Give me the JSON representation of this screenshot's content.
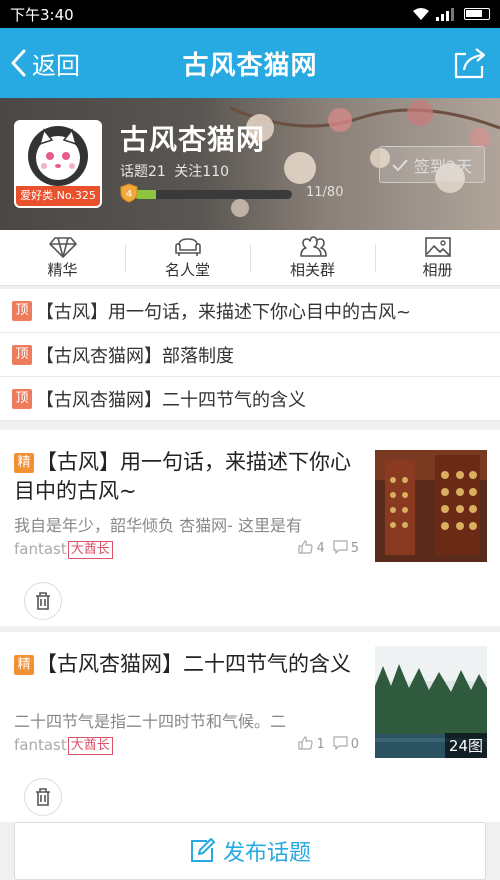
{
  "status_bar": {
    "time": "下午3:40"
  },
  "nav": {
    "back_label": "返回",
    "title": "古风杏猫网"
  },
  "tribe": {
    "name": "古风杏猫网",
    "topics_label": "话题21",
    "follow_label": "关注110",
    "rank_badge": "爱好类.No.325",
    "level": "4",
    "progress_text": "11/80",
    "progress_fraction": 0.1375,
    "checkin_label": "签到2天"
  },
  "tabs": [
    {
      "label": "精华",
      "icon": "diamond-icon"
    },
    {
      "label": "名人堂",
      "icon": "sofa-icon"
    },
    {
      "label": "相关群",
      "icon": "group-icon"
    },
    {
      "label": "相册",
      "icon": "photo-icon"
    }
  ],
  "pinned": {
    "tag": "顶",
    "items": [
      "【古风】用一句话，来描述下你心目中的古风~",
      "【古风杏猫网】部落制度",
      "【古风杏猫网】二十四节气的含义"
    ]
  },
  "posts": [
    {
      "tag": "精",
      "title": "【古风】用一句话，来描述下你心目中的古风~",
      "excerpt": "我自是年少，韶华倾负 杏猫网- 这里是有",
      "author": "fantast",
      "author_badge": "大酋长",
      "likes": "4",
      "comments": "5"
    },
    {
      "tag": "精",
      "title": "【古风杏猫网】二十四节气的含义",
      "excerpt": "二十四节气是指二十四时节和气候。二",
      "author": "fantast",
      "author_badge": "大酋长",
      "likes": "1",
      "comments": "0",
      "image_count": "24图"
    }
  ],
  "publish": {
    "label": "发布话题"
  },
  "colors": {
    "primary": "#27a9e1",
    "pin_tag": "#ed7c5c",
    "essence_tag": "#f29035",
    "badge": "#e9512d"
  }
}
